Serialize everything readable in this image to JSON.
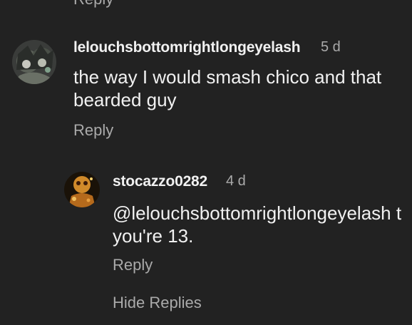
{
  "top": {
    "reply_label": "Reply"
  },
  "comment": {
    "username": "lelouchsbottomrightlongeyelash",
    "timestamp": "5 d",
    "text_line1": "the way I would smash chico and that",
    "text_line2": "bearded guy",
    "reply_label": "Reply",
    "avatar_icon": "anime-character-avatar"
  },
  "reply": {
    "username": "stocazzo0282",
    "timestamp": "4 d",
    "text_line1": "@lelouchsbottomrightlongeyelash t",
    "text_line2": "you're 13.",
    "reply_label": "Reply",
    "avatar_icon": "orange-character-avatar"
  },
  "hide_replies_label": "Hide Replies",
  "colors": {
    "background": "#222222",
    "primary_text": "#f1f1f1",
    "secondary_text": "#aaaaaa"
  }
}
